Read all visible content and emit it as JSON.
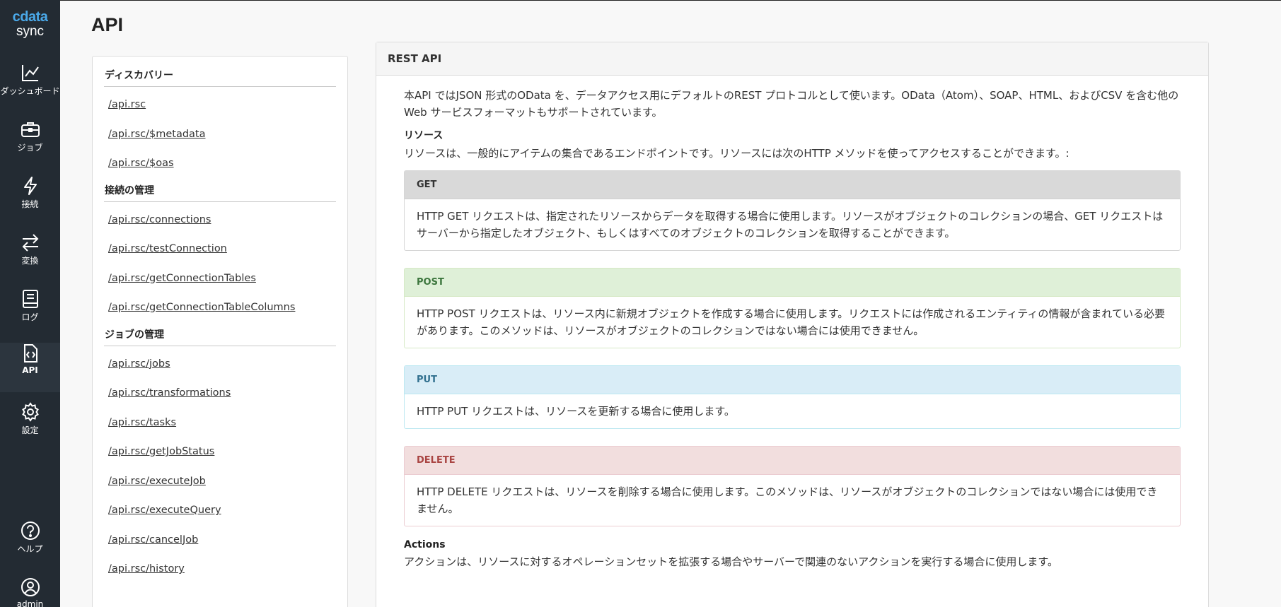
{
  "brand": {
    "top": "cdata",
    "bottom": "sync"
  },
  "nav": [
    {
      "label": "ダッシュボード",
      "icon": "chart-line-icon",
      "active": false
    },
    {
      "label": "ジョブ",
      "icon": "briefcase-icon",
      "active": false
    },
    {
      "label": "接続",
      "icon": "lightning-icon",
      "active": false
    },
    {
      "label": "変換",
      "icon": "arrows-exchange-icon",
      "active": false
    },
    {
      "label": "ログ",
      "icon": "book-icon",
      "active": false
    },
    {
      "label": "API",
      "icon": "code-file-icon",
      "active": true
    },
    {
      "label": "設定",
      "icon": "gear-icon",
      "active": false
    },
    {
      "label": "ヘルプ",
      "icon": "help-circle-icon",
      "active": false
    },
    {
      "label": "admin",
      "icon": "user-circle-icon",
      "active": false
    }
  ],
  "page_title": "API",
  "toc": [
    {
      "heading": "ディスカバリー",
      "links": [
        "/api.rsc",
        "/api.rsc/$metadata",
        "/api.rsc/$oas"
      ]
    },
    {
      "heading": "接続の管理",
      "links": [
        "/api.rsc/connections",
        "/api.rsc/testConnection",
        "/api.rsc/getConnectionTables",
        "/api.rsc/getConnectionTableColumns"
      ]
    },
    {
      "heading": "ジョブの管理",
      "links": [
        "/api.rsc/jobs",
        "/api.rsc/transformations",
        "/api.rsc/tasks",
        "/api.rsc/getJobStatus",
        "/api.rsc/executeJob",
        "/api.rsc/executeQuery",
        "/api.rsc/cancelJob",
        "/api.rsc/history"
      ]
    }
  ],
  "panel": {
    "title": "REST API",
    "intro": "本API ではJSON 形式のOData を、データアクセス用にデフォルトのREST プロトコルとして使います。OData（Atom）、SOAP、HTML、およびCSV を含む他のWeb サービスフォーマットもサポートされています。",
    "resources_heading": "リソース",
    "resources_text": "リソースは、一般的にアイテムの集合であるエンドポイントです。リソースには次のHTTP メソッドを使ってアクセスすることができます。:",
    "methods": {
      "get": {
        "name": "GET",
        "text": "HTTP GET リクエストは、指定されたリソースからデータを取得する場合に使用します。リソースがオブジェクトのコレクションの場合、GET リクエストはサーバーから指定したオブジェクト、もしくはすべてのオブジェクトのコレクションを取得することができます。"
      },
      "post": {
        "name": "POST",
        "text": "HTTP POST リクエストは、リソース内に新規オブジェクトを作成する場合に使用します。リクエストには作成されるエンティティの情報が含まれている必要があります。このメソッドは、リソースがオブジェクトのコレクションではない場合には使用できません。"
      },
      "put": {
        "name": "PUT",
        "text": "HTTP PUT リクエストは、リソースを更新する場合に使用します。"
      },
      "delete": {
        "name": "DELETE",
        "text": "HTTP DELETE リクエストは、リソースを削除する場合に使用します。このメソッドは、リソースがオブジェクトのコレクションではない場合には使用できません。"
      }
    },
    "actions_heading": "Actions",
    "actions_text": "アクションは、リソースに対するオペレーションセットを拡張する場合やサーバーで関連のないアクションを実行する場合に使用します。"
  },
  "colors": {
    "rail_bg": "#232b33",
    "brand_accent": "#4aa8e8",
    "get_head": "#d9d9d9",
    "post_head": "#dff0d8",
    "put_head": "#d9edf7",
    "delete_head": "#f2dede"
  }
}
